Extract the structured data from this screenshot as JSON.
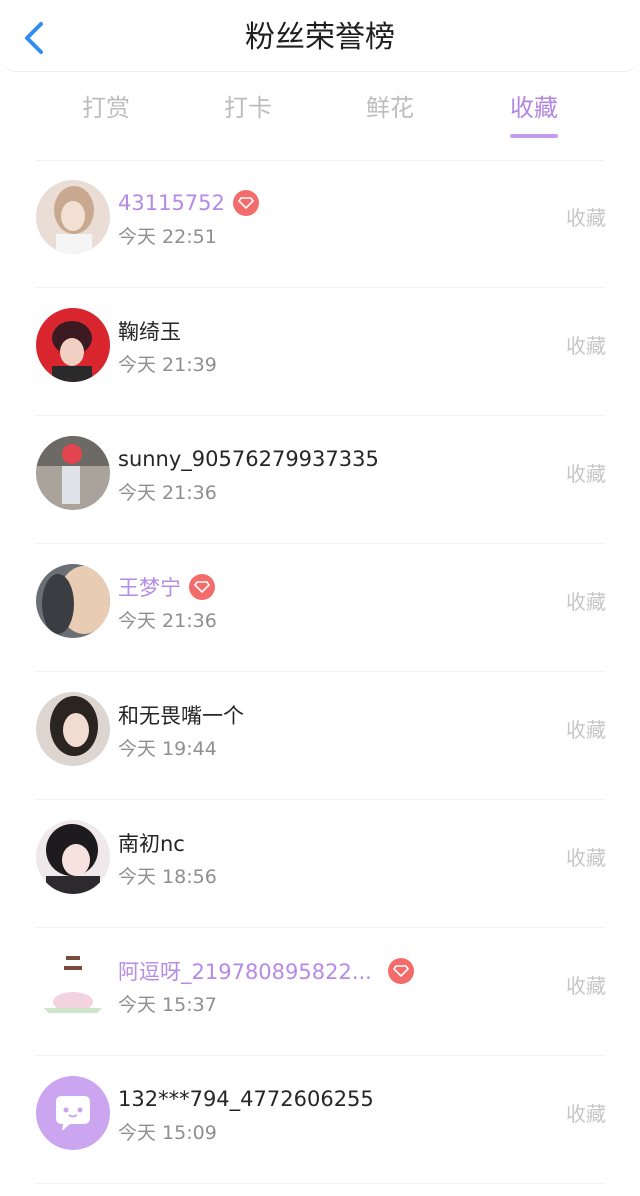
{
  "header": {
    "title": "粉丝荣誉榜"
  },
  "tabs": [
    {
      "label": "打赏"
    },
    {
      "label": "打卡"
    },
    {
      "label": "鲜花"
    },
    {
      "label": "收藏"
    }
  ],
  "active_tab": "收藏",
  "items": [
    {
      "name": "43115752",
      "time": "今天 22:51",
      "action": "收藏",
      "vip": true
    },
    {
      "name": "鞠绮玉",
      "time": "今天 21:39",
      "action": "收藏",
      "vip": false
    },
    {
      "name": "sunny_90576279937335",
      "time": "今天 21:36",
      "action": "收藏",
      "vip": false
    },
    {
      "name": "王梦宁",
      "time": "今天 21:36",
      "action": "收藏",
      "vip": true
    },
    {
      "name": "和无畏嘴一个",
      "time": "今天 19:44",
      "action": "收藏",
      "vip": false
    },
    {
      "name": "南初nc",
      "time": "今天 18:56",
      "action": "收藏",
      "vip": false
    },
    {
      "name": "阿逗呀_219780895822...",
      "time": "今天 15:37",
      "action": "收藏",
      "vip": true
    },
    {
      "name": "132***794_4772606255",
      "time": "今天 15:09",
      "action": "收藏",
      "vip": false
    }
  ],
  "colors": {
    "accent": "#b388e3",
    "vip_badge": "#f46b6b",
    "back_arrow": "#2f8df2"
  }
}
